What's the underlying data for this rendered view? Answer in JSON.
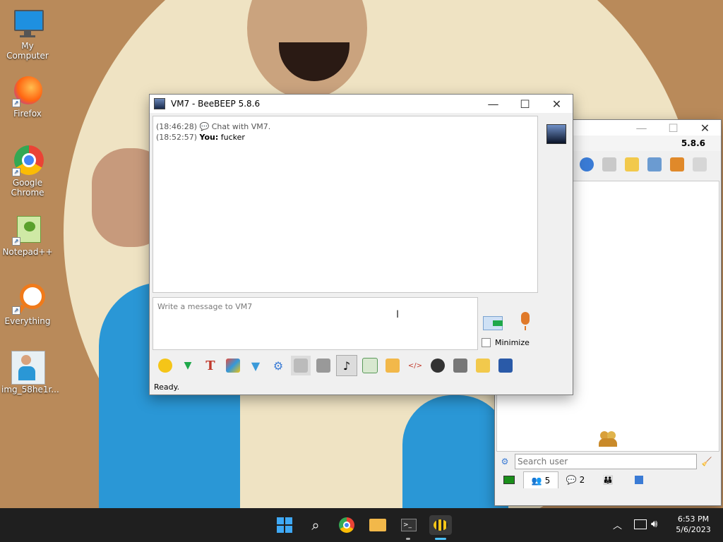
{
  "desktop": {
    "icons": [
      {
        "label": "My Computer"
      },
      {
        "label": "Firefox"
      },
      {
        "label": "Google Chrome"
      },
      {
        "label": "Notepad++"
      },
      {
        "label": "Everything"
      },
      {
        "label": "img_58he1r..."
      }
    ]
  },
  "chat_window": {
    "title": "VM7 - BeeBEEP 5.8.6",
    "messages": [
      {
        "time": "(18:46:28)",
        "sender": "",
        "text": "Chat with VM7."
      },
      {
        "time": "(18:52:57)",
        "sender": "You:",
        "text": "fucker"
      }
    ],
    "input_placeholder": "Write a message to VM7",
    "minimize_label": "Minimize",
    "status": "Ready."
  },
  "main_window": {
    "version": "5.8.6",
    "search_placeholder": "Search user",
    "tabs": [
      {
        "label": "",
        "icon": "network-icon"
      },
      {
        "label": "5",
        "icon": "users-icon"
      },
      {
        "label": "2",
        "icon": "chats-icon"
      },
      {
        "label": "",
        "icon": "groups-icon"
      },
      {
        "label": "",
        "icon": "files-icon"
      }
    ]
  },
  "taskbar": {
    "time": "6:53 PM",
    "date": "5/6/2023"
  },
  "colors": {
    "taskbar_bg": "#1f1f1f",
    "accent": "#0078d4",
    "window_bg": "#f0f0f0"
  }
}
